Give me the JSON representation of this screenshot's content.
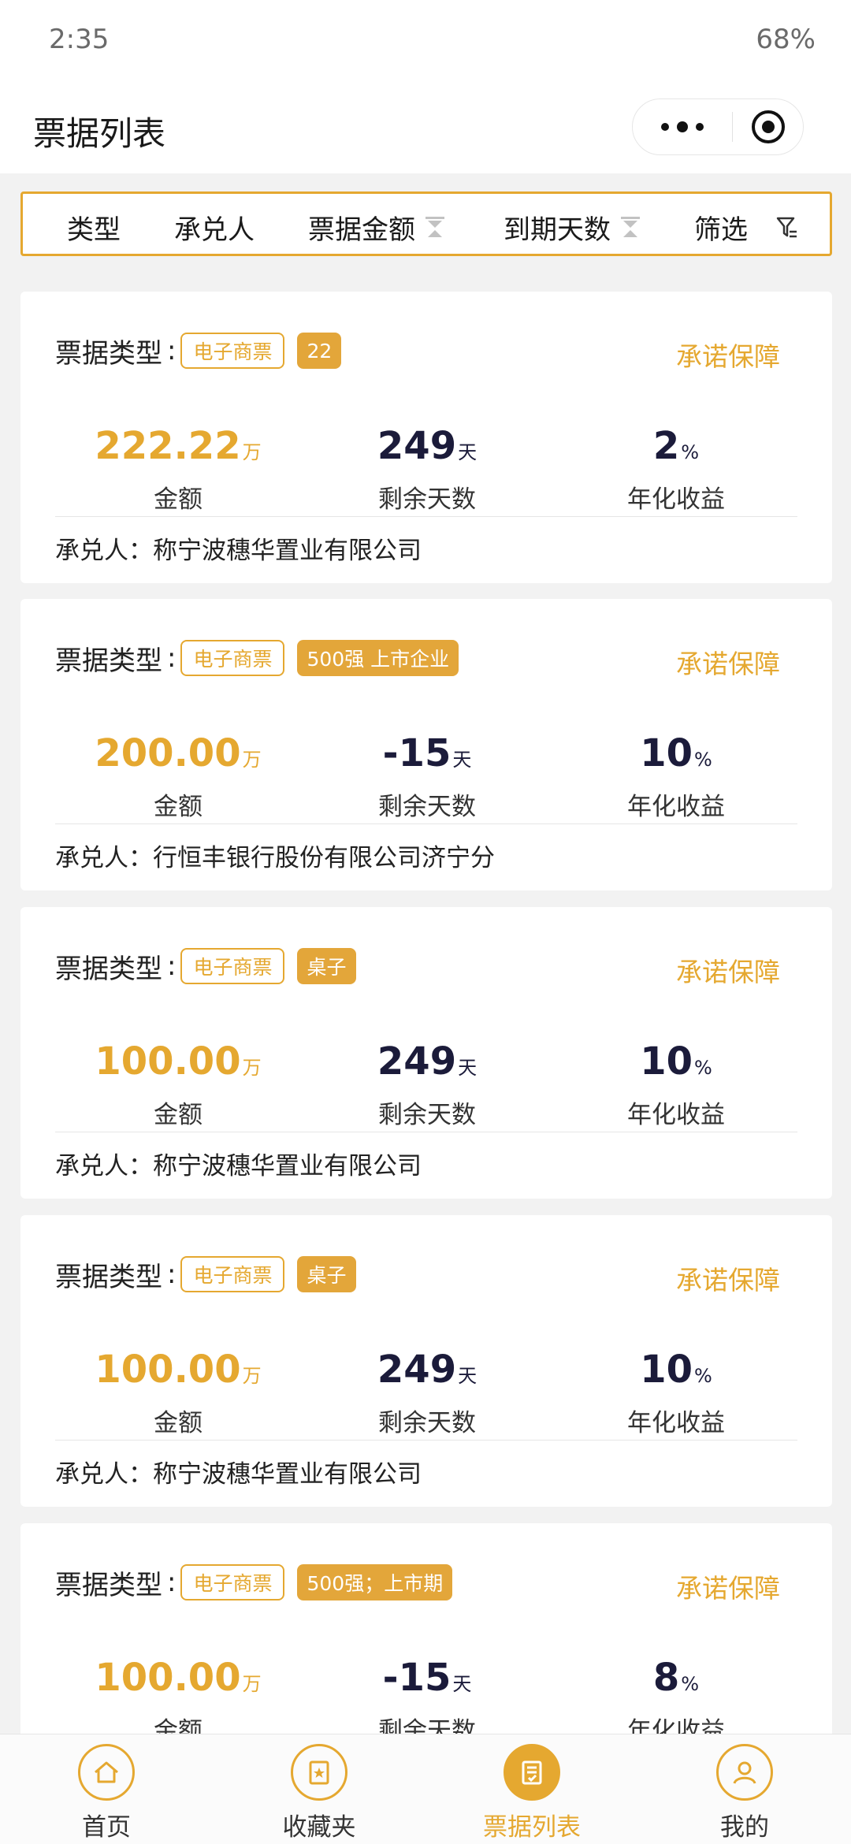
{
  "status": {
    "time": "2:35",
    "battery": "68%"
  },
  "nav": {
    "title": "票据列表"
  },
  "filters": {
    "type": "类型",
    "acceptor": "承兑人",
    "amount": "票据金额",
    "days": "到期天数",
    "filter": "筛选"
  },
  "labels": {
    "bill_type": "票据类型",
    "colon": ":",
    "promise": "承诺保障",
    "amount": "金额",
    "days": "剩余天数",
    "yield": "年化收益",
    "acceptor_prefix": "承兑人：",
    "unit_amount": "万",
    "unit_days": "天",
    "unit_yield": "%"
  },
  "cards": [
    {
      "type_tag": "电子商票",
      "extra_tag": "22",
      "amount": "222.22",
      "days": "249",
      "yield": "2",
      "acceptor": "称宁波穗华置业有限公司"
    },
    {
      "type_tag": "电子商票",
      "extra_tag": "500强 上市企业",
      "amount": "200.00",
      "days": "-15",
      "yield": "10",
      "acceptor": "行恒丰银行股份有限公司济宁分"
    },
    {
      "type_tag": "电子商票",
      "extra_tag": "桌子",
      "amount": "100.00",
      "days": "249",
      "yield": "10",
      "acceptor": "称宁波穗华置业有限公司"
    },
    {
      "type_tag": "电子商票",
      "extra_tag": "桌子",
      "amount": "100.00",
      "days": "249",
      "yield": "10",
      "acceptor": "称宁波穗华置业有限公司"
    },
    {
      "type_tag": "电子商票",
      "extra_tag": "500强；上市期",
      "amount": "100.00",
      "days": "-15",
      "yield": "8",
      "acceptor": ""
    }
  ],
  "tabs": [
    {
      "label": "首页",
      "icon": "home-icon"
    },
    {
      "label": "收藏夹",
      "icon": "favorites-icon"
    },
    {
      "label": "票据列表",
      "icon": "bill-list-icon"
    },
    {
      "label": "我的",
      "icon": "profile-icon"
    }
  ],
  "colors": {
    "accent": "#e5a830",
    "dark_value": "#1b1b3a"
  }
}
